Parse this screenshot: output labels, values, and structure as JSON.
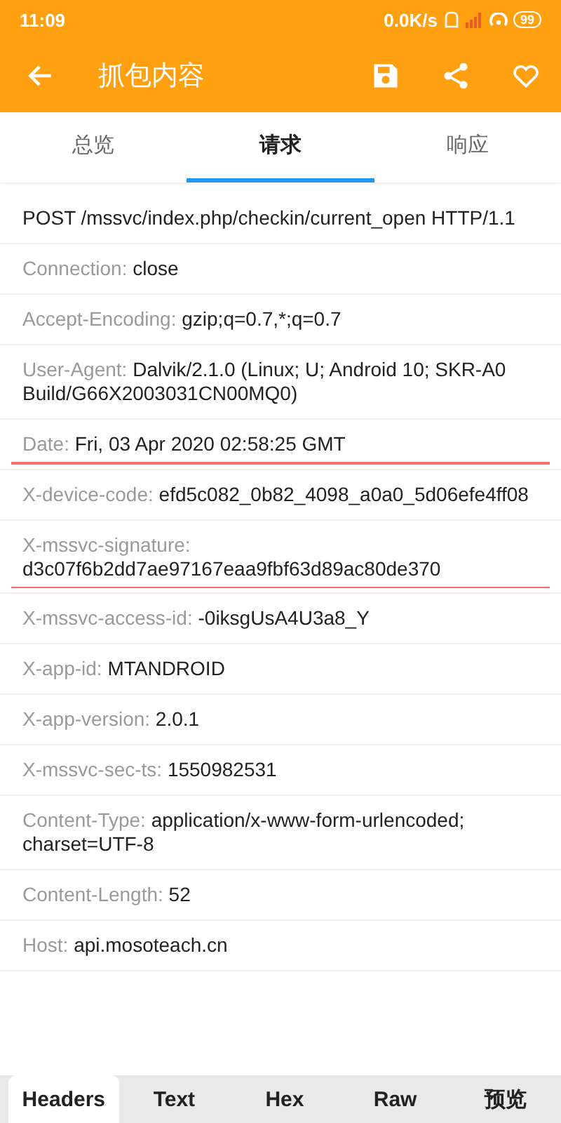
{
  "status_bar": {
    "time": "11:09",
    "speed": "0.0K/s",
    "battery": "99"
  },
  "toolbar": {
    "title": "抓包内容"
  },
  "tabs": [
    {
      "label": "总览",
      "selected": false
    },
    {
      "label": "请求",
      "selected": true
    },
    {
      "label": "响应",
      "selected": false
    }
  ],
  "request_line": "POST /mssvc/index.php/checkin/current_open HTTP/1.1",
  "headers": [
    {
      "name": "Connection:",
      "value": "close",
      "underlined": false
    },
    {
      "name": "Accept-Encoding:",
      "value": "gzip;q=0.7,*;q=0.7",
      "underlined": false
    },
    {
      "name": "User-Agent:",
      "value": "Dalvik/2.1.0 (Linux; U; Android 10; SKR-A0 Build/G66X2003031CN00MQ0)",
      "underlined": false
    },
    {
      "name": "Date:",
      "value": "Fri, 03 Apr 2020 02:58:25 GMT",
      "underlined": true
    },
    {
      "name": "X-device-code:",
      "value": "efd5c082_0b82_4098_a0a0_5d06efe4ff08",
      "underlined": false
    },
    {
      "name": "X-mssvc-signature:",
      "value": "d3c07f6b2dd7ae97167eaa9fbf63d89ac80de370",
      "underlined": true
    },
    {
      "name": "X-mssvc-access-id:",
      "value": "-0iksgUsA4U3a8_Y",
      "underlined": false
    },
    {
      "name": "X-app-id:",
      "value": "MTANDROID",
      "underlined": false
    },
    {
      "name": "X-app-version:",
      "value": "2.0.1",
      "underlined": false
    },
    {
      "name": "X-mssvc-sec-ts:",
      "value": "1550982531",
      "underlined": false
    },
    {
      "name": "Content-Type:",
      "value": "application/x-www-form-urlencoded; charset=UTF-8",
      "underlined": false
    },
    {
      "name": "Content-Length:",
      "value": "52",
      "underlined": false
    },
    {
      "name": "Host:",
      "value": "api.mosoteach.cn",
      "underlined": false
    }
  ],
  "bottom_tabs": [
    {
      "label": "Headers",
      "selected": true
    },
    {
      "label": "Text",
      "selected": false
    },
    {
      "label": "Hex",
      "selected": false
    },
    {
      "label": "Raw",
      "selected": false
    },
    {
      "label": "预览",
      "selected": false
    }
  ]
}
